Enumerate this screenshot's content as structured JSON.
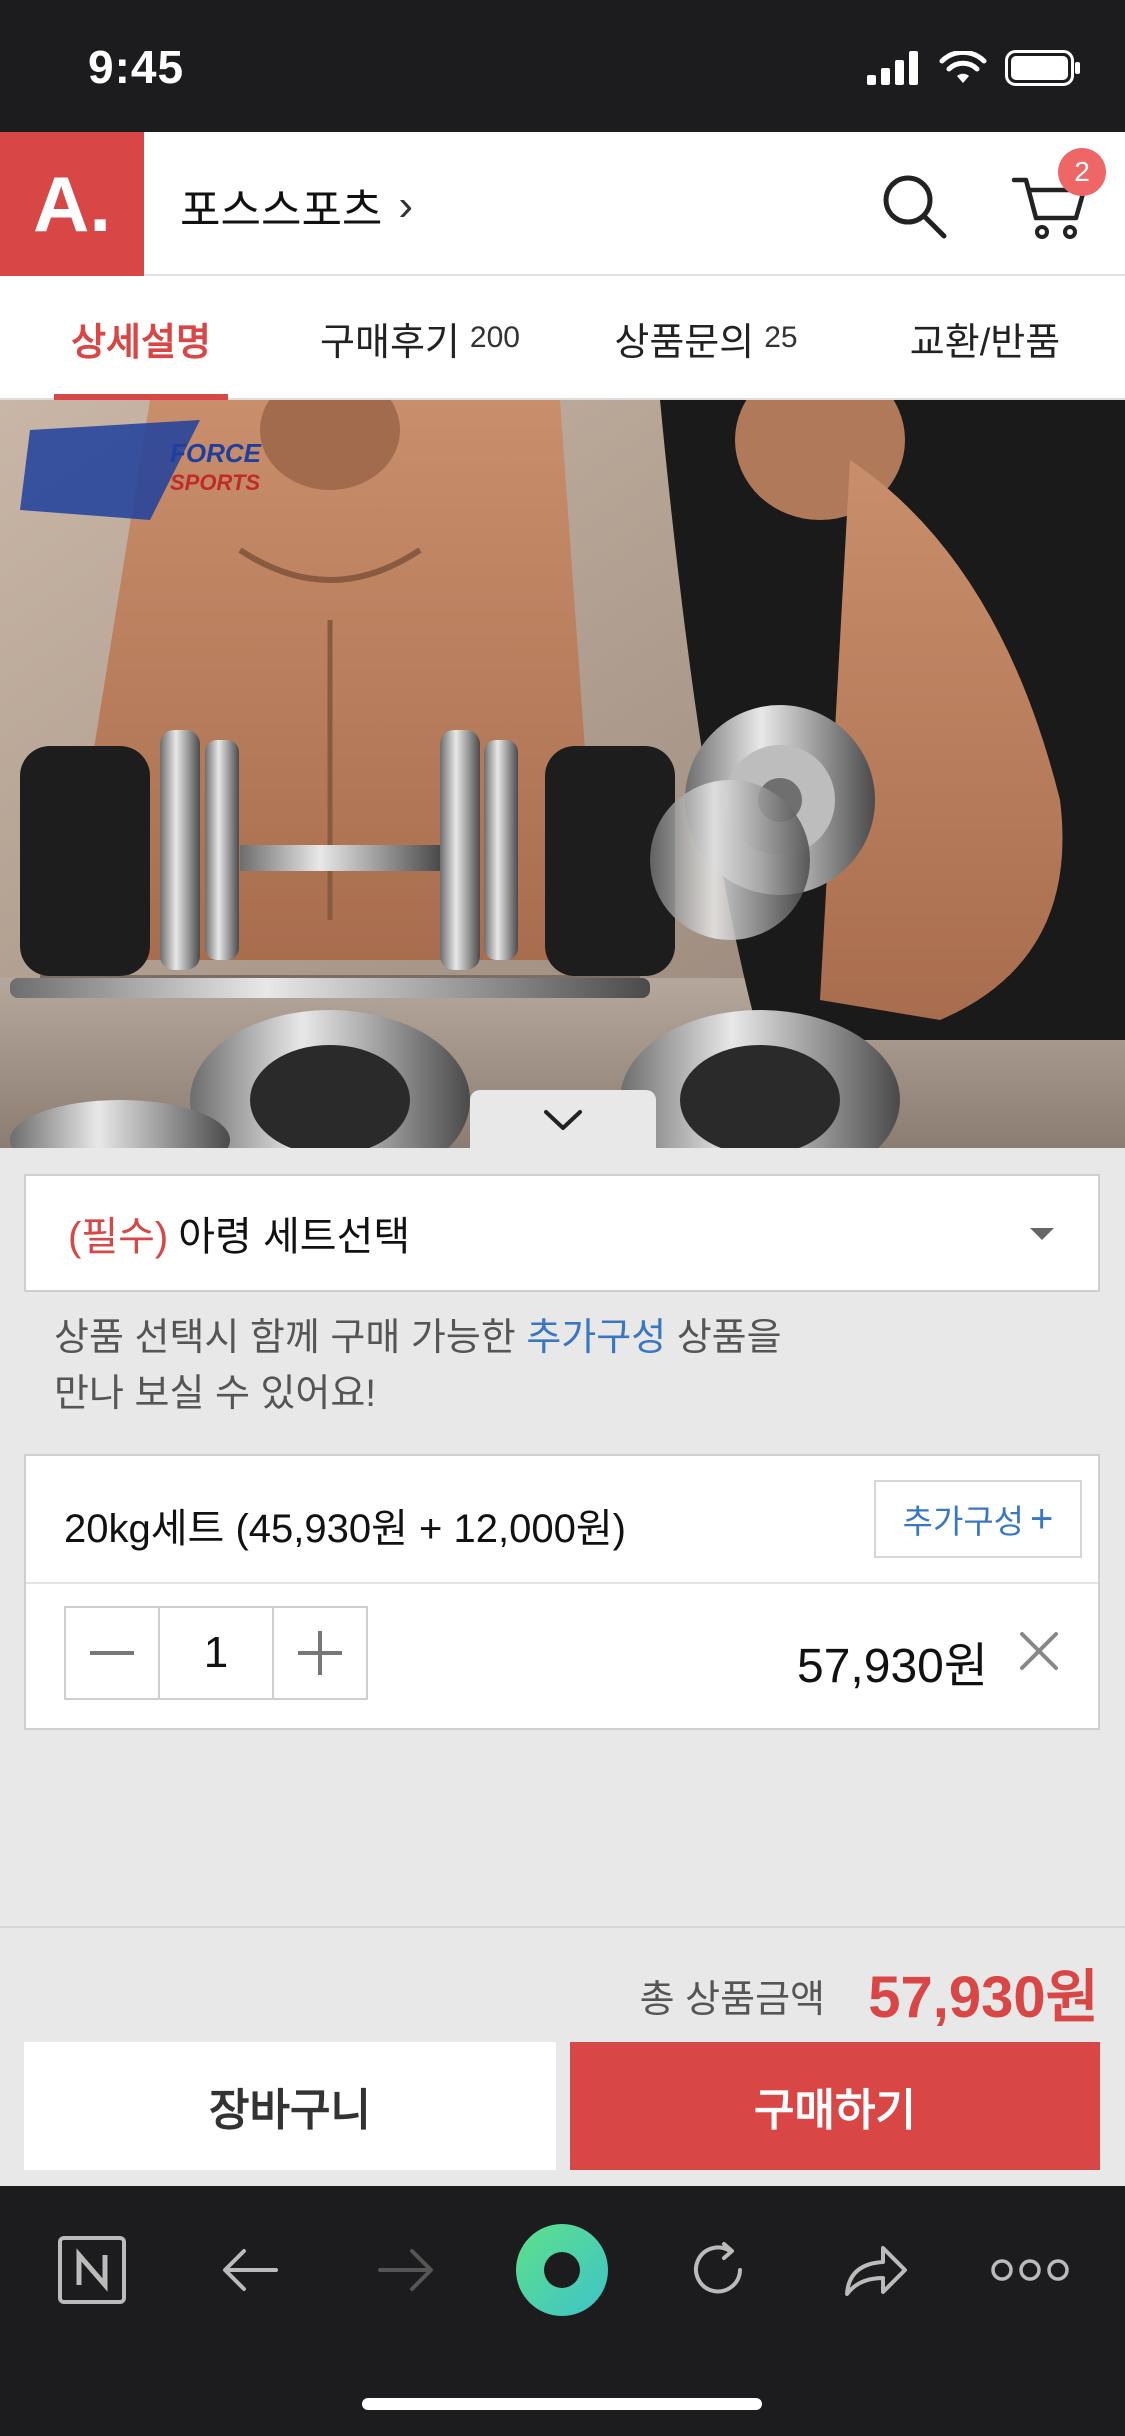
{
  "status_bar": {
    "time": "9:45"
  },
  "header": {
    "logo_text": "A.",
    "store_name": "포스스포츠",
    "store_chevron": "›",
    "cart_badge": "2"
  },
  "tabs": [
    {
      "label": "상세설명",
      "count": "",
      "active": true
    },
    {
      "label": "구매후기",
      "count": "200",
      "active": false
    },
    {
      "label": "상품문의",
      "count": "25",
      "active": false
    },
    {
      "label": "교환/반품",
      "count": "",
      "active": false
    }
  ],
  "hero": {
    "brand_line1": "FORCE",
    "brand_line2": "SPORTS"
  },
  "options": {
    "required_tag": "(필수)",
    "select_label": "아령 세트선택",
    "hint_before": "상품 선택시 함께 구매 가능한 ",
    "hint_link": "추가구성",
    "hint_after": " 상품을",
    "hint_line2": "만나 보실 수 있어요!"
  },
  "selected_item": {
    "name": "20kg세트 (45,930원 + 12,000원)",
    "addon_label": "추가구성",
    "addon_plus": "+",
    "quantity": "1",
    "price": "57,930원"
  },
  "total": {
    "label": "총 상품금액",
    "value": "57,930원"
  },
  "actions": {
    "cart_label": "장바구니",
    "buy_label": "구매하기"
  },
  "browser_bar": {
    "icons": [
      "naver-n-icon",
      "back-arrow-icon",
      "forward-arrow-icon",
      "green-dot-home-icon",
      "refresh-icon",
      "share-icon",
      "more-icon"
    ]
  },
  "colors": {
    "brand_red": "#d94646",
    "link_blue": "#3a77c2",
    "dark_bar": "#1c1c1e"
  }
}
